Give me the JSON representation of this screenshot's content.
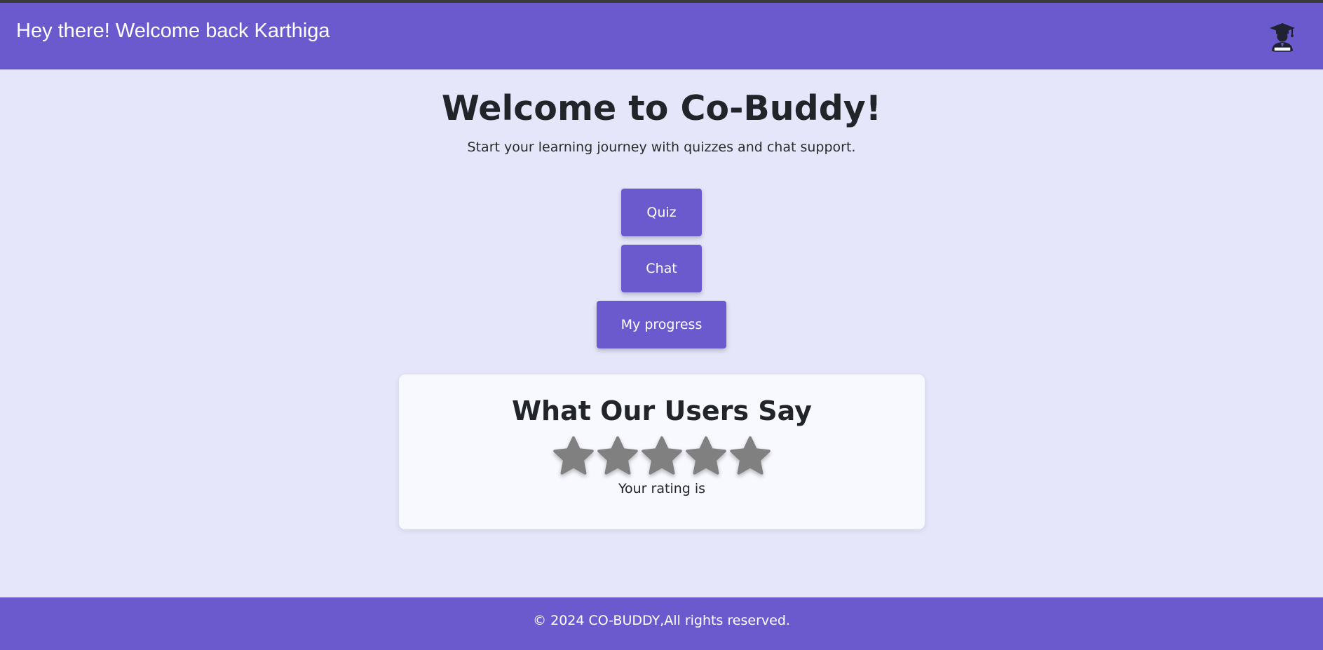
{
  "header": {
    "greeting": "Hey there! Welcome back Karthiga",
    "avatar_icon": "graduate-user-icon",
    "background_color": "#6a5acd"
  },
  "hero": {
    "title": "Welcome to Co-Buddy!",
    "subtitle": "Start your learning journey with quizzes and chat support."
  },
  "actions": {
    "quiz_label": "Quiz",
    "chat_label": "Chat",
    "progress_label": "My progress",
    "button_color": "#6a5acd"
  },
  "reviews": {
    "title": "What Our Users Say",
    "star_icon": "star-icon",
    "star_count": 5,
    "star_color": "#808080",
    "rating_text": "Your rating is"
  },
  "footer": {
    "text": "© 2024 CO-BUDDY,All rights reserved."
  },
  "theme": {
    "page_background": "#e6e6fa",
    "card_background": "#f8f8ff"
  }
}
